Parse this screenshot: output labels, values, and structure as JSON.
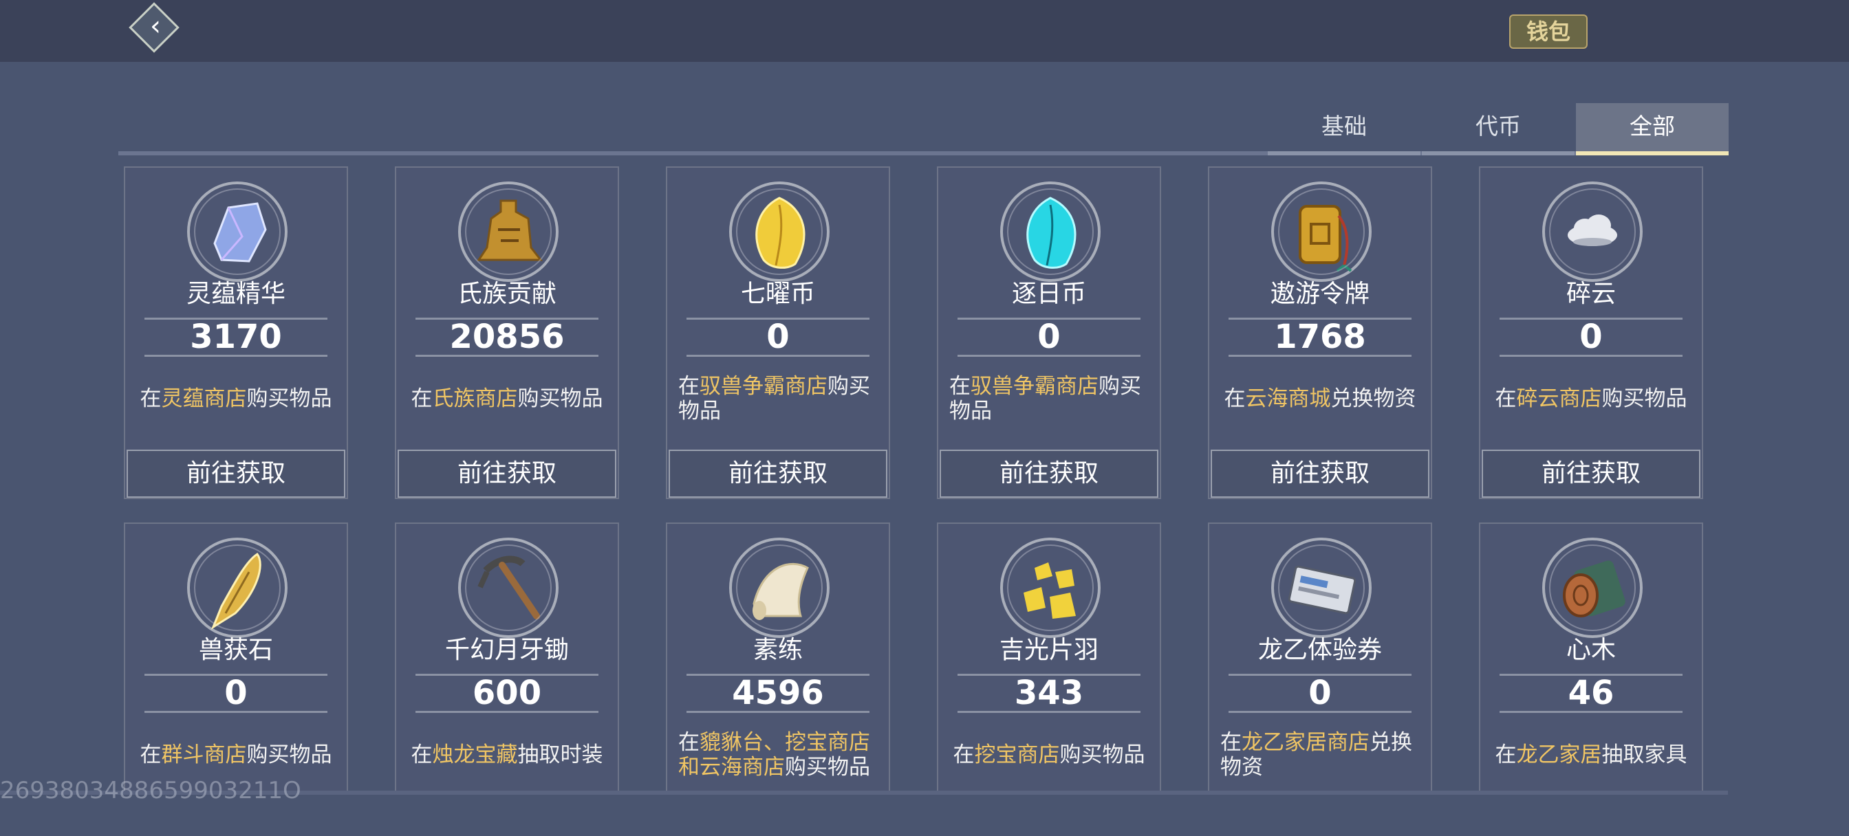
{
  "header": {
    "wallet_label": "钱包"
  },
  "tabs": [
    {
      "label": "基础"
    },
    {
      "label": "代币"
    },
    {
      "label": "全部"
    }
  ],
  "active_tab": "全部",
  "go_button_label": "前往获取",
  "items": [
    {
      "name": "灵蕴精华",
      "count": "3170",
      "desc": [
        {
          "t": "在"
        },
        {
          "t": "灵蕴商店",
          "hl": true
        },
        {
          "t": "购买物品"
        }
      ],
      "icon": "crystal-icon",
      "color": "#8fa6e6"
    },
    {
      "name": "氏族贡献",
      "count": "20856",
      "desc": [
        {
          "t": "在"
        },
        {
          "t": "氏族商店",
          "hl": true
        },
        {
          "t": "购买物品"
        }
      ],
      "icon": "bronze-coin-icon",
      "color": "#c2902f"
    },
    {
      "name": "七曜币",
      "count": "0",
      "desc": [
        {
          "t": "在"
        },
        {
          "t": "驭兽争霸商店",
          "hl": true
        },
        {
          "t": "购买物品"
        }
      ],
      "icon": "gold-leaf-icon",
      "color": "#f0cc3a"
    },
    {
      "name": "逐日币",
      "count": "0",
      "desc": [
        {
          "t": "在"
        },
        {
          "t": "驭兽争霸商店",
          "hl": true
        },
        {
          "t": "购买物品"
        }
      ],
      "icon": "cyan-leaf-icon",
      "color": "#28d6e4"
    },
    {
      "name": "遨游令牌",
      "count": "1768",
      "desc": [
        {
          "t": "在"
        },
        {
          "t": "云海商城",
          "hl": true
        },
        {
          "t": "兑换物资"
        }
      ],
      "icon": "token-plaque-icon",
      "color": "#d3a12d"
    },
    {
      "name": "碎云",
      "count": "0",
      "desc": [
        {
          "t": "在"
        },
        {
          "t": "碎云商店",
          "hl": true
        },
        {
          "t": "购买物品"
        }
      ],
      "icon": "cloud-icon",
      "color": "#e6e8ee"
    },
    {
      "name": "兽获石",
      "count": "0",
      "desc": [
        {
          "t": "在"
        },
        {
          "t": "群斗商店",
          "hl": true
        },
        {
          "t": "购买物品"
        }
      ],
      "icon": "feather-stone-icon",
      "color": "#e0b546"
    },
    {
      "name": "千幻月牙锄",
      "count": "600",
      "desc": [
        {
          "t": "在"
        },
        {
          "t": "烛龙宝藏",
          "hl": true
        },
        {
          "t": "抽取时装"
        }
      ],
      "icon": "pickaxe-icon",
      "color": "#9a6a3c"
    },
    {
      "name": "素练",
      "count": "4596",
      "desc": [
        {
          "t": "在"
        },
        {
          "t": "貔貅台、挖宝商店和云海商店",
          "hl": true
        },
        {
          "t": "购买物品"
        }
      ],
      "icon": "silk-scroll-icon",
      "color": "#efe6cf"
    },
    {
      "name": "吉光片羽",
      "count": "343",
      "desc": [
        {
          "t": "在"
        },
        {
          "t": "挖宝商店",
          "hl": true
        },
        {
          "t": "购买物品"
        }
      ],
      "icon": "gold-shards-icon",
      "color": "#f1d23c"
    },
    {
      "name": "龙乙体验券",
      "count": "0",
      "desc": [
        {
          "t": "在"
        },
        {
          "t": "龙乙家居商店",
          "hl": true
        },
        {
          "t": "兑换物资"
        }
      ],
      "icon": "ticket-icon",
      "color": "#d9dde5"
    },
    {
      "name": "心木",
      "count": "46",
      "desc": [
        {
          "t": "在"
        },
        {
          "t": "龙乙家居",
          "hl": true
        },
        {
          "t": "抽取家具"
        }
      ],
      "icon": "wood-log-icon",
      "color": "#b5683a"
    }
  ],
  "watermark": "2693803488659903211O"
}
